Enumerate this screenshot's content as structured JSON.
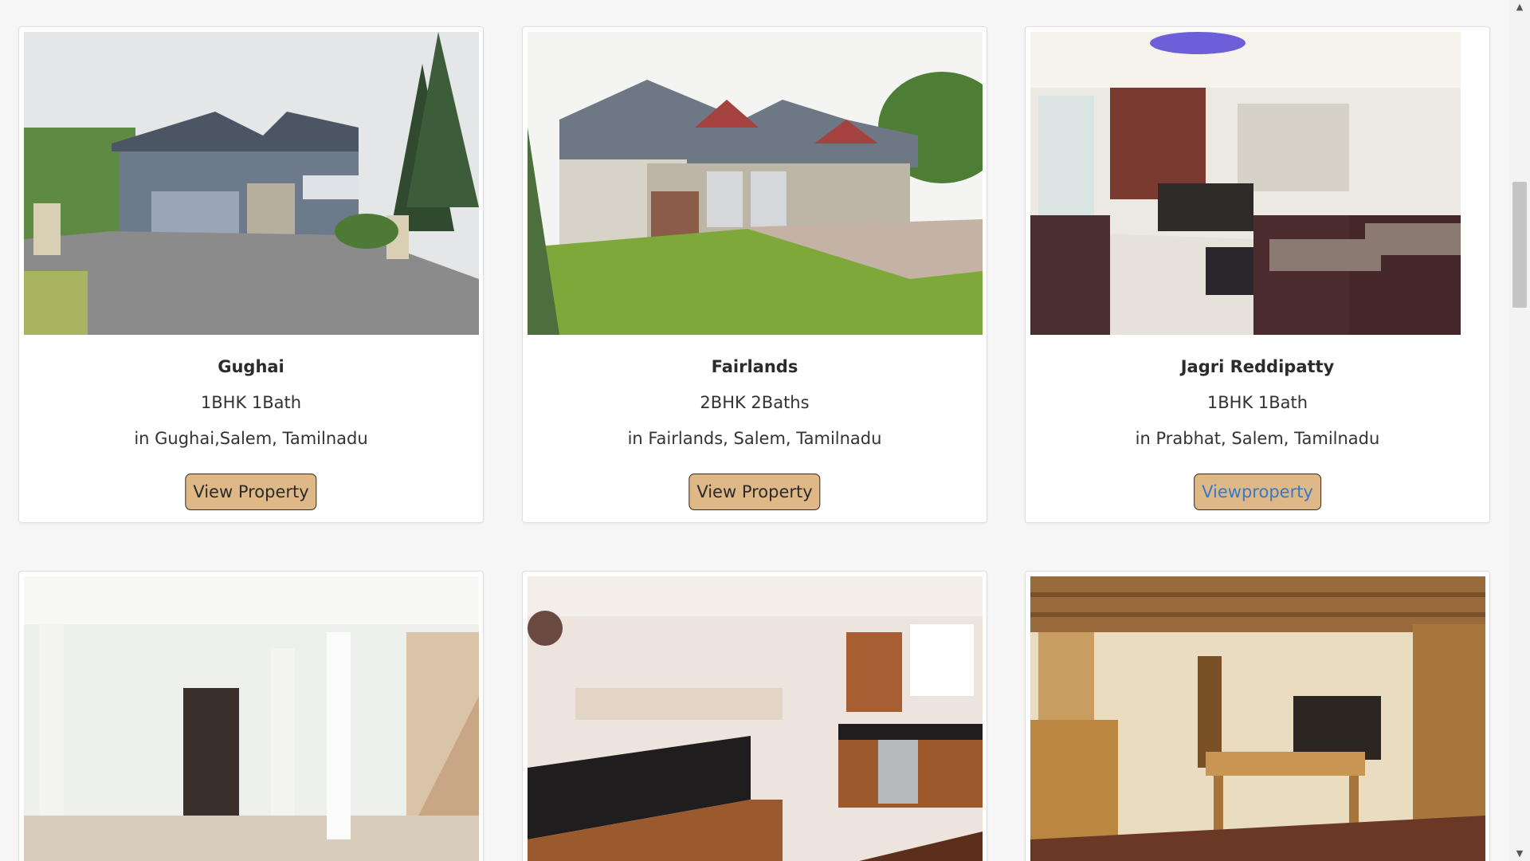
{
  "properties": [
    {
      "title": "Gughai",
      "rooms": "1BHK 1Bath",
      "location": "in Gughai,Salem, Tamilnadu",
      "button": "View Property",
      "photo": "house-exterior-driveway"
    },
    {
      "title": "Fairlands",
      "rooms": "2BHK 2Baths",
      "location": "in Fairlands, Salem, Tamilnadu",
      "button": "View Property",
      "photo": "house-exterior-lawn"
    },
    {
      "title": "Jagri Reddipatty",
      "rooms": "1BHK 1Bath",
      "location": "in Prabhat, Salem, Tamilnadu",
      "button": "Viewproperty",
      "photo": "living-room-interior"
    },
    {
      "photo": "empty-white-interior"
    },
    {
      "photo": "kitchen-interior"
    },
    {
      "photo": "rustic-dining-room"
    }
  ],
  "colors": {
    "page_background": "#f6f6f6",
    "button_background": "#deb887",
    "button_border": "#3a2a18",
    "link_text": "#3a78c4"
  },
  "scrollbar": {
    "up_icon": "triangle-up-icon",
    "down_icon": "triangle-down-icon"
  }
}
